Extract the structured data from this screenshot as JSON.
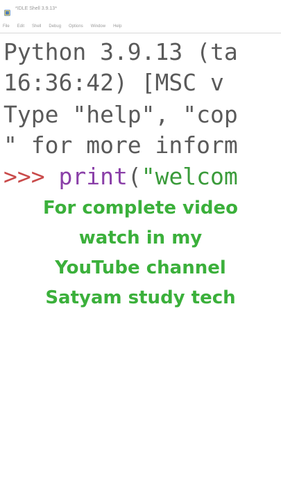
{
  "window": {
    "title": "*IDLE Shell 3.9.13*"
  },
  "menu": {
    "items": [
      "File",
      "Edit",
      "Shell",
      "Debug",
      "Options",
      "Window",
      "Help"
    ]
  },
  "shell": {
    "line1": "Python 3.9.13 (ta",
    "line2": "16:36:42) [MSC v",
    "line3": "Type \"help\", \"cop",
    "line4": "\" for more inform",
    "prompt": ">>> ",
    "print_kw": "print",
    "paren": "(",
    "str_partial": "\"welcom"
  },
  "overlay": {
    "lines": [
      "For complete video",
      "watch in my",
      "YouTube channel",
      "Satyam study tech"
    ]
  },
  "colors": {
    "overlay_text": "#3bb03b",
    "prompt": "#c94a4a",
    "keyword": "#8a3fa8",
    "string": "#3a9b3a"
  },
  "icons": {
    "app": "idle-app-icon"
  }
}
